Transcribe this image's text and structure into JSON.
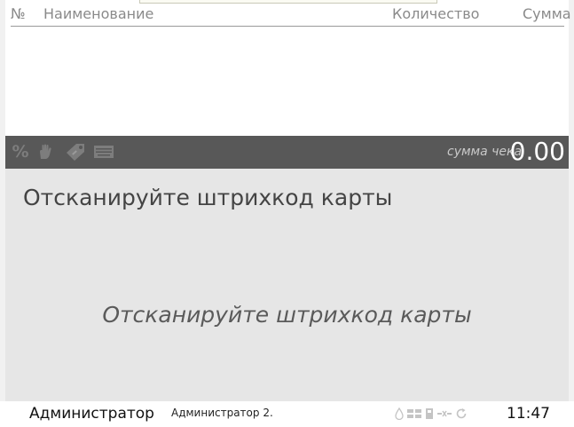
{
  "table": {
    "headers": {
      "number": "№",
      "name": "Наименование",
      "quantity": "Количество",
      "sum": "Сумма"
    },
    "rows": []
  },
  "receipt_bar": {
    "tools": [
      "percent-icon",
      "hand-icon",
      "tag-icon",
      "keyboard-icon"
    ],
    "percent_glyph": "%",
    "total_label": "сумма чека",
    "total_value": "0.00"
  },
  "main_panel": {
    "title": "Отсканируйте штрихкод карты",
    "hint": "Отсканируйте штрихкод карты"
  },
  "status_bar": {
    "user": "Администратор",
    "sub_user": "Администратор 2.",
    "icons": [
      "drop-icon",
      "network-icon",
      "storage-icon",
      "disconnected-icon",
      "sync-icon"
    ],
    "time": "11:47"
  },
  "colors": {
    "receipt_bar": "#585858",
    "main_panel": "#e6e6e6",
    "header_text": "#8a8a8a"
  }
}
